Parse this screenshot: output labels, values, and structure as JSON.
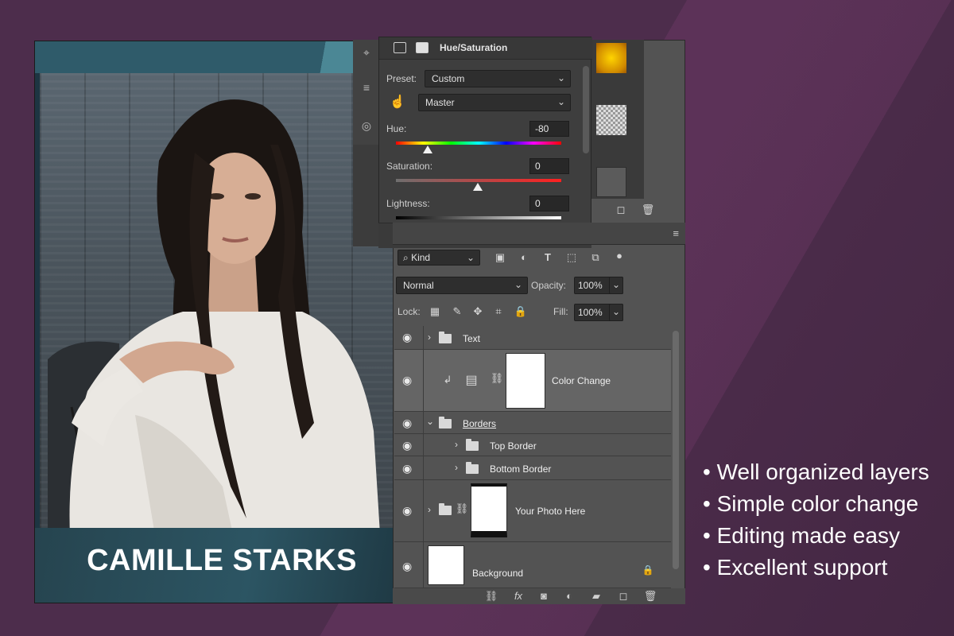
{
  "poster": {
    "name": "CAMILLE STARKS"
  },
  "hue_sat": {
    "title": "Hue/Saturation",
    "preset_label": "Preset:",
    "preset_value": "Custom",
    "channel_value": "Master",
    "hue_label": "Hue:",
    "hue_value": "-80",
    "saturation_label": "Saturation:",
    "saturation_value": "0",
    "lightness_label": "Lightness:",
    "lightness_value": "0"
  },
  "layers_panel": {
    "filter_kind": "Kind",
    "blend_mode": "Normal",
    "opacity_label": "Opacity:",
    "opacity_value": "100%",
    "lock_label": "Lock:",
    "fill_label": "Fill:",
    "fill_value": "100%",
    "layers": [
      {
        "name": "Text"
      },
      {
        "name": "Color Change"
      },
      {
        "name": "Borders"
      },
      {
        "name": "Top Border"
      },
      {
        "name": "Bottom Border"
      },
      {
        "name": "Your Photo Here"
      },
      {
        "name": "Background"
      }
    ]
  },
  "features": [
    "Well organized layers",
    "Simple color change",
    "Editing made easy",
    "Excellent support"
  ]
}
